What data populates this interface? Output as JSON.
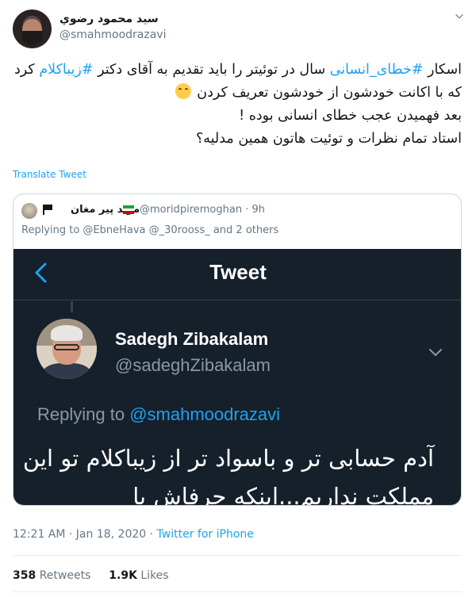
{
  "author": {
    "display_name": "سید محمود رضوي",
    "handle": "@smahmoodrazavi",
    "avatar_icon": "profile-avatar"
  },
  "tweet": {
    "text_parts": [
      {
        "type": "text",
        "text": "اسکار "
      },
      {
        "type": "hashtag",
        "text": "#خطای_انسانی"
      },
      {
        "type": "text",
        "text": " سال در توئیتر را باید تقدیم به آقای دکتر "
      },
      {
        "type": "hashtag",
        "text": "#زیباکلام"
      },
      {
        "type": "text",
        "text": " کرد که با اکانت خودشون از خودشون تعریف کردن "
      },
      {
        "type": "emoji",
        "text": "😂"
      },
      {
        "type": "text",
        "text": "\nبعد فهمیدن عجب خطای انسانی بوده !\nاستاد تمام نظرات و توئیت هاتون همین مدلیه؟"
      }
    ],
    "translate_label": "Translate Tweet",
    "timestamp": "12:21 AM · Jan 18, 2020",
    "separator": " · ",
    "source": "Twitter for iPhone",
    "retweets_count": "358",
    "retweets_label": "Retweets",
    "likes_count": "1.9K",
    "likes_label": "Likes"
  },
  "quoted_tweet": {
    "display_name": "مرید پیر مغان",
    "handle_time": "@moridpiremoghan · 9h",
    "replying_to": "Replying to @EbneHava @_30rooss_ and 2 others",
    "screenshot": {
      "header_title": "Tweet",
      "author_name": "Sadegh Zibakalam",
      "author_handle": "@sadeghZibakalam",
      "replying_prefix": "Replying to ",
      "replying_mention": "@smahmoodrazavi",
      "text": "آدم حسابی تر و باسواد تر از زیباکلام تو این مملکت نداریم...اینکه حرفاش با"
    }
  },
  "colors": {
    "link": "#1da1f2",
    "muted": "#657786",
    "screenshot_bg": "#15202b"
  }
}
